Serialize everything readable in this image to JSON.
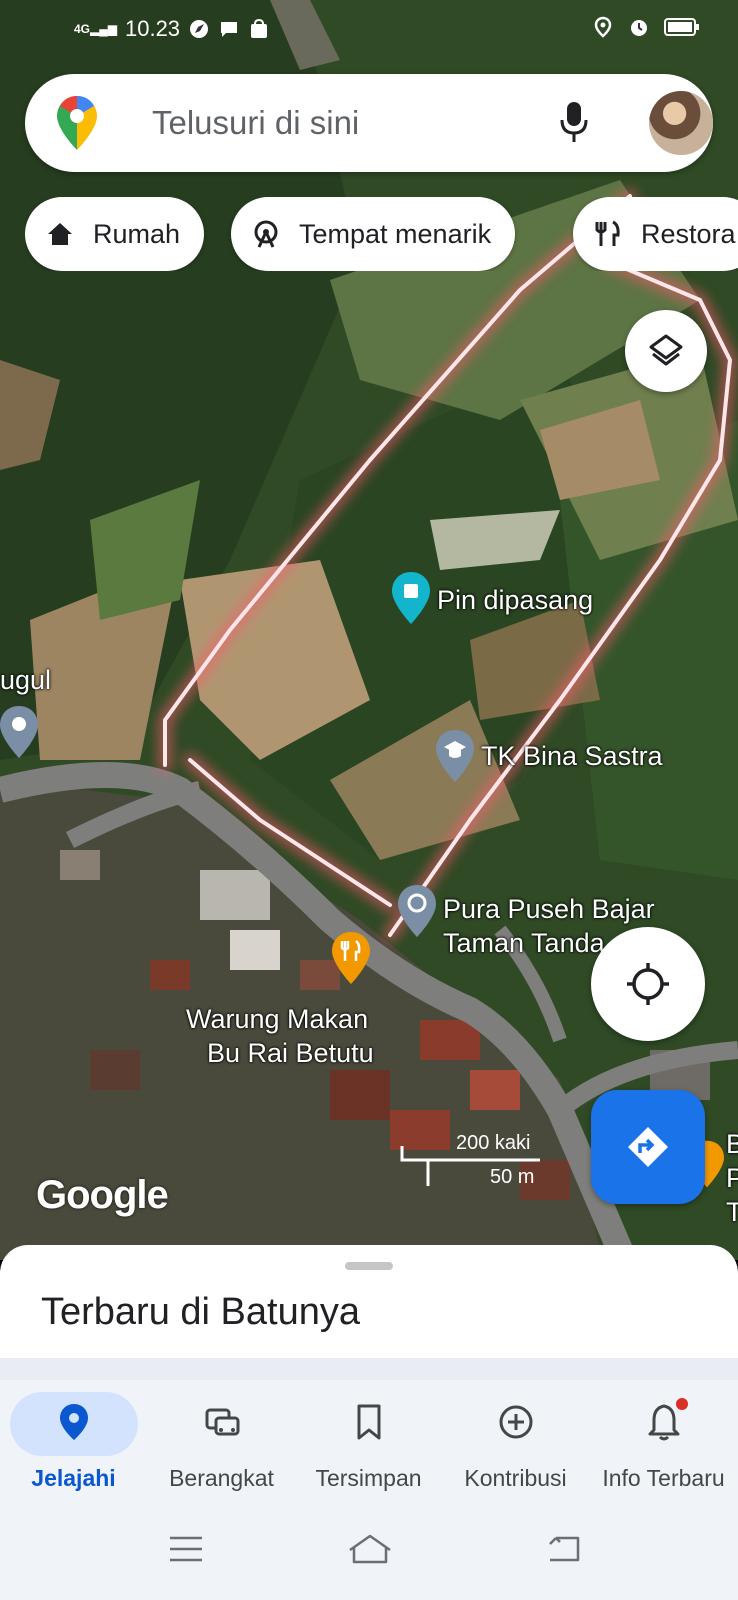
{
  "status_bar": {
    "signal": "4G",
    "time": "10.23"
  },
  "search": {
    "placeholder": "Telusuri di sini"
  },
  "chips": [
    {
      "label": "Rumah",
      "icon": "home-icon"
    },
    {
      "label": "Tempat menarik",
      "icon": "ferris-wheel-icon"
    },
    {
      "label": "Restora",
      "icon": "restaurant-icon"
    }
  ],
  "map": {
    "labels": {
      "dropped_pin": "Pin dipasang",
      "school": "TK Bina Sastra",
      "temple_line1": "Pura Puseh Bajar",
      "temple_line2": "Taman Tanda",
      "restaurant_line1": "Warung Makan",
      "restaurant_line2": "Bu Rai Betutu",
      "partial_left": "ugul",
      "partial_right_1": "B",
      "partial_right_2": "P",
      "partial_right_3": "T"
    },
    "attribution": "Google",
    "scale": {
      "imperial": "200 kaki",
      "metric": "50 m"
    }
  },
  "sheet": {
    "title": "Terbaru di Batunya"
  },
  "bottom_nav": [
    {
      "label": "Jelajahi",
      "icon": "location-pin-icon",
      "active": true
    },
    {
      "label": "Berangkat",
      "icon": "commute-icon",
      "active": false
    },
    {
      "label": "Tersimpan",
      "icon": "bookmark-icon",
      "active": false
    },
    {
      "label": "Kontribusi",
      "icon": "add-circle-icon",
      "active": false
    },
    {
      "label": "Info Terbaru",
      "icon": "bell-icon",
      "active": false
    }
  ],
  "colors": {
    "accent": "#1a73e8",
    "active_nav": "#0b57d0",
    "restaurant_pin": "#f29900",
    "pin_teal": "#12b5cb",
    "highlight": "#ff6b7a"
  }
}
